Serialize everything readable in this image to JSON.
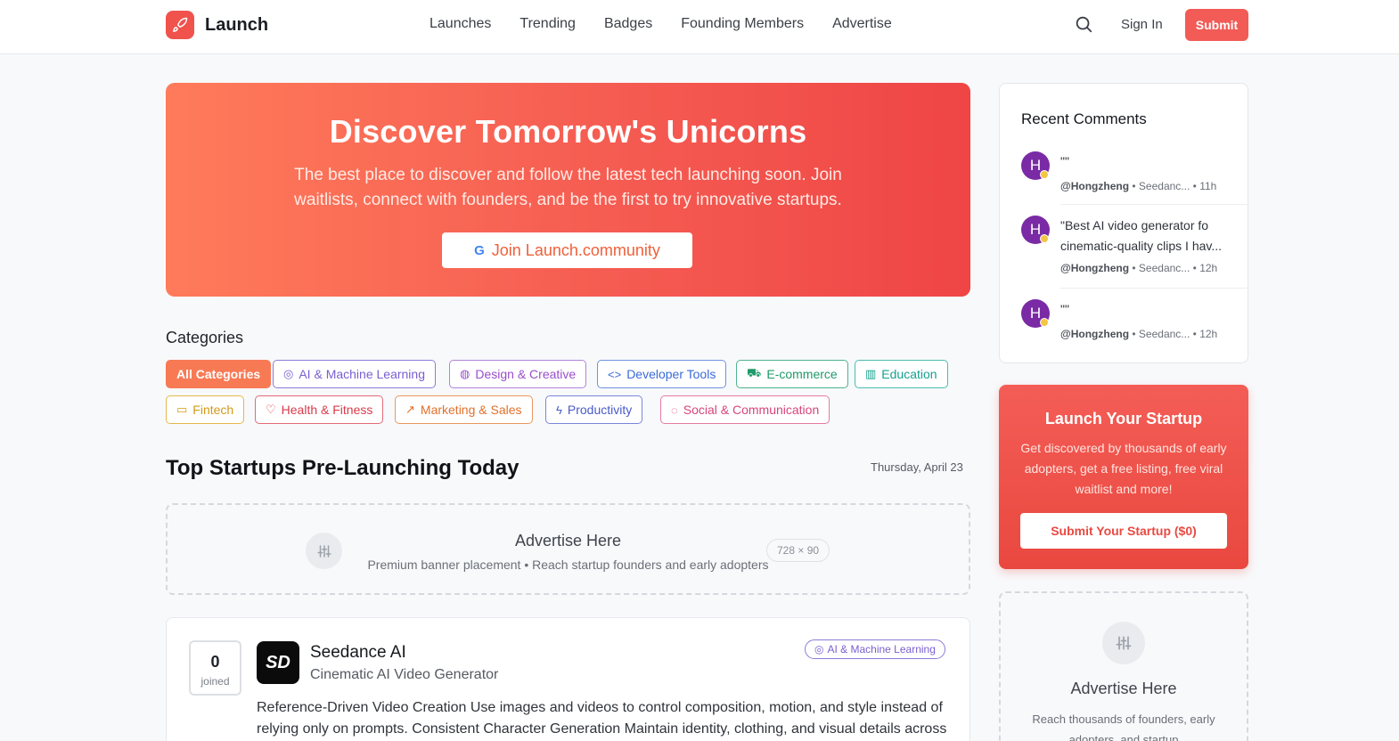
{
  "header": {
    "brand": "Launch",
    "nav": [
      "Launches",
      "Trending",
      "Badges",
      "Founding Members",
      "Advertise"
    ],
    "search_icon": "search-icon",
    "sign_in": "Sign In",
    "submit": "Submit"
  },
  "hero": {
    "title": "Discover Tomorrow's Unicorns",
    "subtitle": "The best place to discover and follow the latest tech launching soon. Join waitlists, connect with founders, and be the first to try innovative startups.",
    "button": "Join Launch.community",
    "accent": "#f25b56"
  },
  "categories": {
    "title": "Categories",
    "items": [
      {
        "label": "All Categories",
        "icon": "",
        "color": "#f77a55",
        "active": true
      },
      {
        "label": "AI & Machine Learning",
        "icon": "brain-icon",
        "color": "#7a5fd0"
      },
      {
        "label": "Design & Creative",
        "icon": "palette-icon",
        "color": "#9a4fc9"
      },
      {
        "label": "Developer Tools",
        "icon": "code-icon",
        "color": "#3a6ad6"
      },
      {
        "label": "E-commerce",
        "icon": "cart-icon",
        "color": "#1f9a6a"
      },
      {
        "label": "Education",
        "icon": "book-icon",
        "color": "#16a08f"
      },
      {
        "label": "Fintech",
        "icon": "card-icon",
        "color": "#d49a16"
      },
      {
        "label": "Health & Fitness",
        "icon": "heart-icon",
        "color": "#d83a4a"
      },
      {
        "label": "Marketing & Sales",
        "icon": "trend-icon",
        "color": "#e2702c"
      },
      {
        "label": "Productivity",
        "icon": "bolt-icon",
        "color": "#4a59c9"
      },
      {
        "label": "Social & Communication",
        "icon": "chat-icon",
        "color": "#d9437a"
      }
    ]
  },
  "section": {
    "title": "Top Startups Pre-Launching Today",
    "date": "Thursday, April 23"
  },
  "ad_banner": {
    "title": "Advertise Here",
    "subtitle": "Premium banner placement • Reach startup founders and early adopters",
    "size": "728 × 90"
  },
  "product": {
    "votes": "0",
    "votes_label": "joined",
    "logo_text": "SD",
    "name": "Seedance AI",
    "tagline": "Cinematic AI Video Generator",
    "category": "AI & Machine Learning",
    "description": "Reference-Driven Video Creation Use images and videos to control composition, motion, and style instead of relying only on prompts. Consistent Character Generation Maintain identity, clothing, and visual details across"
  },
  "recent_comments": {
    "title": "Recent Comments",
    "items": [
      {
        "avatar": "H",
        "text": "\"\"",
        "user": "@Hongzheng",
        "product": "Seedanc...",
        "time": "11h"
      },
      {
        "avatar": "H",
        "text": "\"Best AI video generator fo cinematic-quality clips I hav...",
        "user": "@Hongzheng",
        "product": "Seedanc...",
        "time": "12h"
      },
      {
        "avatar": "H",
        "text": "\"\"",
        "user": "@Hongzheng",
        "product": "Seedanc...",
        "time": "12h"
      }
    ]
  },
  "launch_card": {
    "title": "Launch Your Startup",
    "text": "Get discovered by thousands of early adopters, get a free listing, free viral waitlist and more!",
    "button": "Submit Your Startup ($0)"
  },
  "side_ad": {
    "title": "Advertise Here",
    "text": "Reach thousands of founders, early adopters, and startup"
  }
}
